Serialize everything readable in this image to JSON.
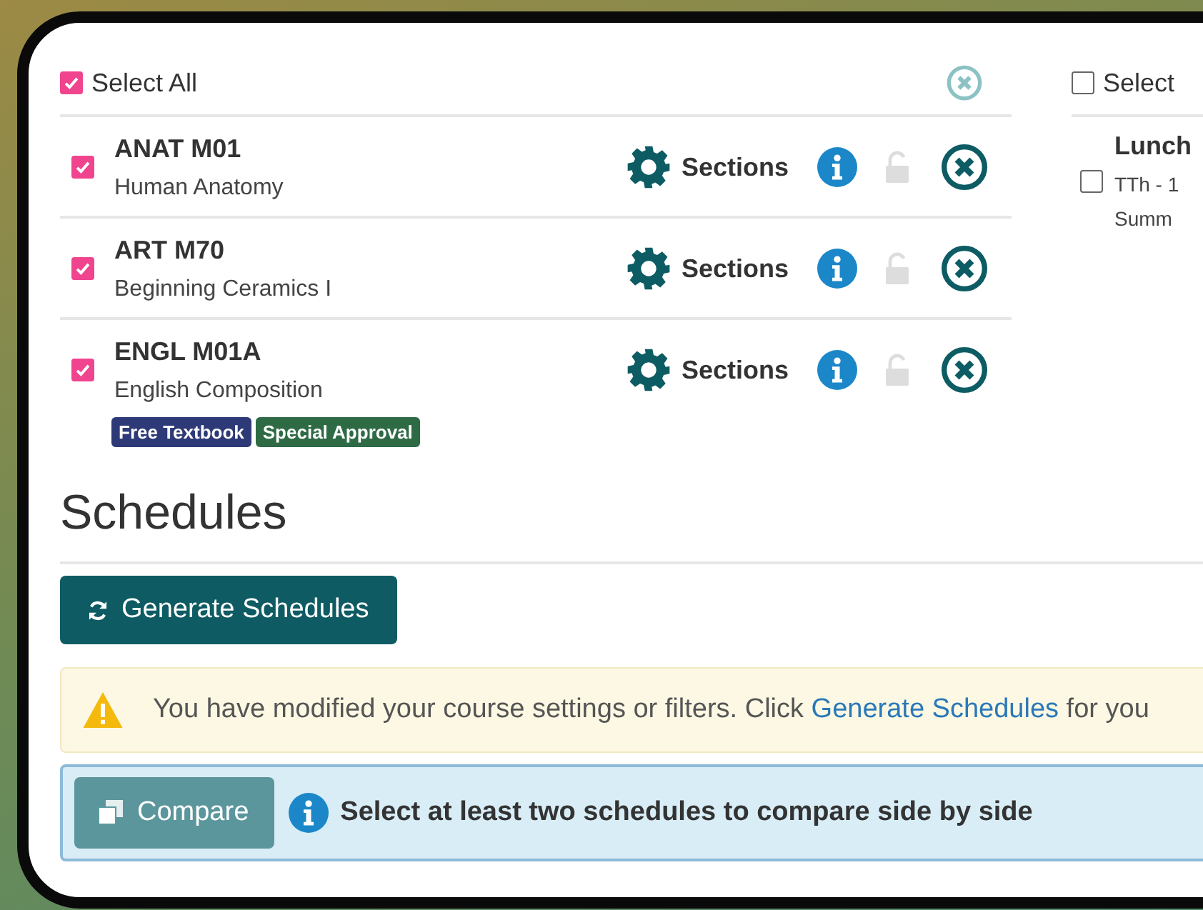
{
  "courses_panel": {
    "select_all": {
      "label": "Select All",
      "checked": true
    },
    "courses": [
      {
        "code": "ANAT M01",
        "title": "Human Anatomy",
        "checked": true,
        "locked": false,
        "action": "Sections"
      },
      {
        "code": "ART M70",
        "title": "Beginning Ceramics I",
        "checked": true,
        "locked": false,
        "action": "Sections"
      },
      {
        "code": "ENGL M01A",
        "title": "English Composition",
        "checked": true,
        "locked": false,
        "action": "Sections",
        "tags": [
          {
            "label": "Free Textbook",
            "color": "#2e3a78"
          },
          {
            "label": "Special Approval",
            "color": "#2e6b45"
          }
        ]
      }
    ]
  },
  "breaks_panel": {
    "select_all": {
      "label": "Select",
      "checked": false
    },
    "breaks": [
      {
        "title": "Lunch",
        "days": "TTh - 1",
        "term": "Summ",
        "checked": false
      }
    ]
  },
  "schedules": {
    "heading": "Schedules",
    "generate_button": "Generate Schedules",
    "warning": {
      "text": "You have modified your course settings or filters. Click ",
      "link": "Generate Schedules",
      "after": " for you"
    },
    "compare_button": "Compare",
    "compare_info": "Select at least two schedules to compare side by side"
  }
}
